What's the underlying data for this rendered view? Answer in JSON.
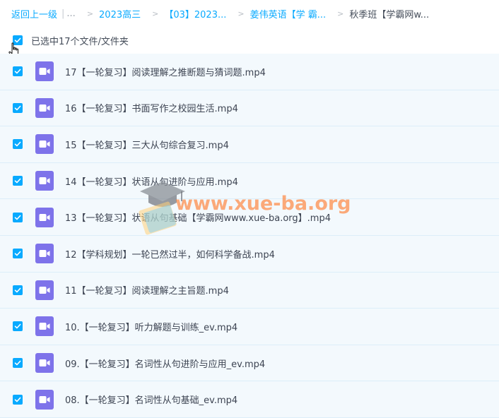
{
  "breadcrumb": {
    "back_label": "返回上一级",
    "ellipsis": "...",
    "items": [
      "2023高三",
      "【03】2023...",
      "姜伟英语【学 霸..."
    ],
    "current": "秋季班【学霸网w..."
  },
  "selection": {
    "label": "已选中17个文件/文件夹",
    "checked": true
  },
  "files": [
    {
      "name": "17【一轮复习】阅读理解之推断题与猜词题.mp4",
      "icon": "video-icon",
      "checked": true
    },
    {
      "name": "16【一轮复习】书面写作之校园生活.mp4",
      "icon": "video-icon",
      "checked": true
    },
    {
      "name": "15【一轮复习】三大从句综合复习.mp4",
      "icon": "video-icon",
      "checked": true
    },
    {
      "name": "14【一轮复习】状语从句进阶与应用.mp4",
      "icon": "video-icon",
      "checked": true
    },
    {
      "name": "13【一轮复习】状语从句基础【学霸网www.xue-ba.org】.mp4",
      "icon": "video-icon",
      "checked": true
    },
    {
      "name": "12【学科规划】一轮已然过半，如何科学备战.mp4",
      "icon": "video-icon",
      "checked": true
    },
    {
      "name": "11【一轮复习】阅读理解之主旨题.mp4",
      "icon": "video-icon",
      "checked": true
    },
    {
      "name": "10.【一轮复习】听力解题与训练_ev.mp4",
      "icon": "video-icon",
      "checked": true
    },
    {
      "name": "09.【一轮复习】名词性从句进阶与应用_ev.mp4",
      "icon": "video-icon",
      "checked": true
    },
    {
      "name": "08.【一轮复习】名词性从句基础_ev.mp4",
      "icon": "video-icon",
      "checked": true
    }
  ],
  "watermark": {
    "text": "www.xue-ba.org",
    "icon": "graduation-cap-icon"
  },
  "colors": {
    "accent": "#09aaff",
    "video_icon": "#7e73ea",
    "row_bg": "#f3f9fd",
    "row_border": "#dceef9",
    "watermark": "#ff7828"
  }
}
